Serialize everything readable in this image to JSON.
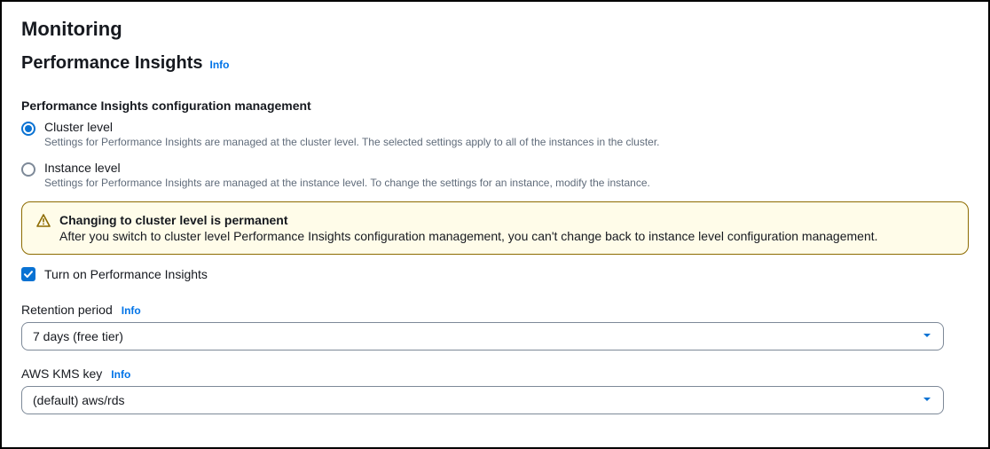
{
  "header": {
    "title": "Monitoring"
  },
  "performance_insights": {
    "title": "Performance Insights",
    "info": "Info"
  },
  "config_mgmt": {
    "group_label": "Performance Insights configuration management",
    "cluster": {
      "label": "Cluster level",
      "desc": "Settings for Performance Insights are managed at the cluster level. The selected settings apply to all of the instances in the cluster."
    },
    "instance": {
      "label": "Instance level",
      "desc": "Settings for Performance Insights are managed at the instance level. To change the settings for an instance, modify the instance."
    }
  },
  "alert": {
    "title": "Changing to cluster level is permanent",
    "body": "After you switch to cluster level Performance Insights configuration management, you can't change back to instance level configuration management."
  },
  "turn_on": {
    "label": "Turn on Performance Insights"
  },
  "retention": {
    "label": "Retention period",
    "info": "Info",
    "value": "7 days (free tier)"
  },
  "kms": {
    "label": "AWS KMS key",
    "info": "Info",
    "value": "(default) aws/rds"
  }
}
